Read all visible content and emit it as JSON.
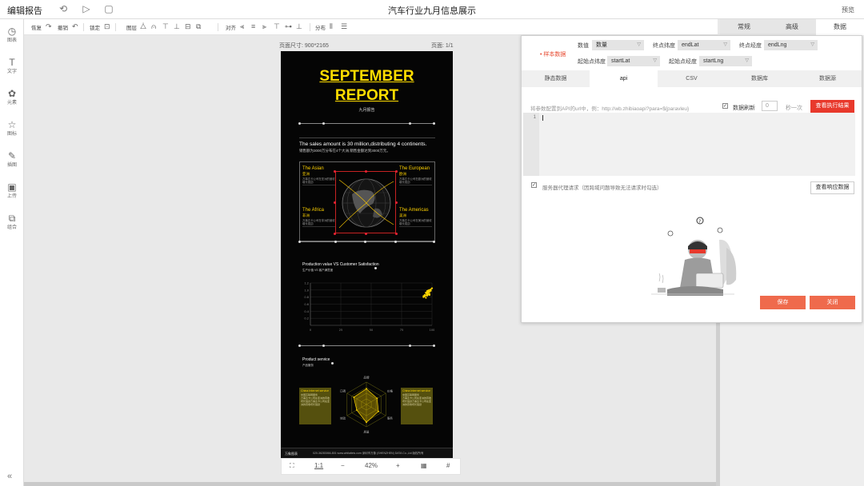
{
  "app": {
    "title": "编辑报告",
    "document_title": "汽车行业九月信息展示",
    "preview_label": "预览"
  },
  "topbar_icons": {
    "back": "back-icon",
    "play": "play-icon",
    "save": "save-icon"
  },
  "sidebar": {
    "items": [
      {
        "label": "图表",
        "icon": "chart-icon",
        "glyph": "◷"
      },
      {
        "label": "文字",
        "icon": "text-icon",
        "glyph": "T"
      },
      {
        "label": "元素",
        "icon": "elements-icon",
        "glyph": "✿"
      },
      {
        "label": "图标",
        "icon": "star-icon",
        "glyph": "☆"
      },
      {
        "label": "插图",
        "icon": "illustration-icon",
        "glyph": "✎"
      },
      {
        "label": "上传",
        "icon": "upload-icon",
        "glyph": "▣"
      },
      {
        "label": "组合",
        "icon": "group-icon",
        "glyph": "⧉"
      }
    ],
    "collapse_glyph": "«"
  },
  "toolbar": {
    "restore": "恢复",
    "undo": "撤销",
    "lock": "锁定",
    "layer": "图层",
    "align": "对齐",
    "distribute": "分布"
  },
  "canvas": {
    "page_size": "页面尺寸: 900*2165",
    "page_num": "页面: 1/1",
    "zoom": "42%",
    "ratio": "1:1",
    "minus": "−",
    "plus": "+"
  },
  "report": {
    "title_line1": "SEPTEMBER",
    "title_line2": "REPORT",
    "subtitle": "九月报告",
    "sales_en": "The sales amount is 30 million,distributing 4 continents.",
    "sales_cn": "销售额为3000万分布在4个大洲,销售金额达到3000万元。",
    "regions": [
      {
        "en": "The Asian",
        "cn": "亚洲",
        "text": "万事达卡公司在亚洲的营收增长强劲"
      },
      {
        "en": "The European",
        "cn": "欧洲",
        "text": "万事达卡公司在欧洲的营收增长强劲"
      },
      {
        "en": "The Africa",
        "cn": "非洲",
        "text": "万事达卡公司在非洲的营收增长强劲"
      },
      {
        "en": "The Americas",
        "cn": "美洲",
        "text": "万事达卡公司在美洲的营收增长强劲"
      }
    ],
    "chart2_title_en": "Production value VS Customer Satisfaction",
    "chart2_title_cn": "生产价值 VS 客户满意度",
    "product_en": "Product service",
    "product_cn": "产品服务",
    "left_box_title": "China Internet service",
    "left_box_sub": "中国互联网服务",
    "left_box_text": "万事达卡公司在亚洲的营收增长强劲万事达卡公司在亚洲的营收增长强劲",
    "right_box_title": "China Internet service",
    "right_box_sub": "中国互联网服务",
    "right_box_text": "万事达卡公司在亚洲的营收增长强劲万事达卡公司在亚洲的营收增长强劲",
    "footer_brand": "万象图表",
    "footer_text": "020-36283066-801    www.wbilaiteis.com    深圳市万象 (SHENZHEN) DATA Co.,Ltd 版权所有"
  },
  "chart_data": [
    {
      "type": "scatter",
      "title": "Production value VS Customer Satisfaction",
      "xlim": [
        0,
        100
      ],
      "ylim": [
        0,
        1.2
      ],
      "yticks": [
        "1.2",
        "1.0",
        "0.8",
        "0.6",
        "0.4",
        "0.2"
      ],
      "xticks": [
        "0",
        "25",
        "50",
        "75",
        "100"
      ],
      "grid": true,
      "points": [
        {
          "x": 96,
          "y": 0.88
        },
        {
          "x": 97,
          "y": 0.92
        },
        {
          "x": 95,
          "y": 0.85
        },
        {
          "x": 98,
          "y": 0.95
        },
        {
          "x": 96,
          "y": 0.9
        },
        {
          "x": 99,
          "y": 0.98
        },
        {
          "x": 94,
          "y": 0.82
        },
        {
          "x": 97,
          "y": 0.87
        },
        {
          "x": 95,
          "y": 0.91
        },
        {
          "x": 98,
          "y": 0.89
        },
        {
          "x": 96,
          "y": 0.94
        },
        {
          "x": 93,
          "y": 0.8
        },
        {
          "x": 97,
          "y": 0.96
        },
        {
          "x": 99,
          "y": 1.02
        },
        {
          "x": 94,
          "y": 0.86
        },
        {
          "x": 95,
          "y": 0.78
        },
        {
          "x": 98,
          "y": 1.0
        },
        {
          "x": 96,
          "y": 0.84
        },
        {
          "x": 97,
          "y": 0.99
        },
        {
          "x": 93,
          "y": 0.83
        },
        {
          "x": 100,
          "y": 1.05
        },
        {
          "x": 95,
          "y": 0.93
        },
        {
          "x": 98,
          "y": 0.86
        },
        {
          "x": 96,
          "y": 0.97
        }
      ]
    },
    {
      "type": "radar",
      "axes": [
        "品牌",
        "价格",
        "服务",
        "质量",
        "体验",
        "口碑"
      ],
      "max": 100,
      "values": [
        70,
        55,
        62,
        80,
        50,
        65
      ]
    }
  ],
  "right_tabs": [
    "常规",
    "高级",
    "数据"
  ],
  "dialog": {
    "sample_label": "• 样本数据",
    "fields": {
      "value_label": "数值",
      "value_value": "数量",
      "end_lat_label": "终点纬度",
      "end_lat_value": "endLat",
      "end_lng_label": "终点经度",
      "end_lng_value": "endLng",
      "start_lat_label": "起始点纬度",
      "start_lat_value": "startLat",
      "start_lng_label": "起始点经度",
      "start_lng_value": "startLng"
    },
    "tabs": [
      "静态数据",
      "api",
      "CSV",
      "数据库",
      "数据源"
    ],
    "active_tab": "api",
    "api_hint": "将参数配置到API的url中，例：http://wb.zhibiaoapi?para=${paravleu}",
    "refresh_label": "数据刷新",
    "refresh_value": "0",
    "per_label": "秒一次",
    "view_result": "查看执行结果",
    "line_number": "1",
    "proxy_label": "服务器代理请求（因跨域问题导致无法请求时勾选）",
    "view_response": "查看响应数据",
    "save": "保存",
    "close": "关闭"
  }
}
